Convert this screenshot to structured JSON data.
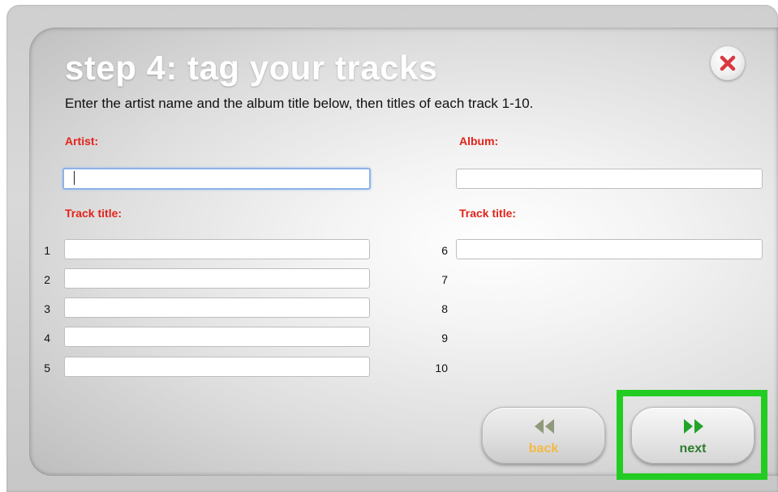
{
  "dialog": {
    "title": "step 4: tag your tracks",
    "instructions": "Enter the artist name and the album title below, then titles of each track 1-10."
  },
  "fields": {
    "artist_label": "Artist:",
    "artist_value": "",
    "album_label": "Album:",
    "album_value": "",
    "track_title_label_left": "Track title:",
    "track_title_label_right": "Track title:"
  },
  "tracks": [
    {
      "number": "1",
      "value": ""
    },
    {
      "number": "2",
      "value": ""
    },
    {
      "number": "3",
      "value": ""
    },
    {
      "number": "4",
      "value": ""
    },
    {
      "number": "5",
      "value": ""
    },
    {
      "number": "6",
      "value": ""
    },
    {
      "number": "7",
      "value": ""
    },
    {
      "number": "8",
      "value": ""
    },
    {
      "number": "9",
      "value": ""
    },
    {
      "number": "10",
      "value": ""
    }
  ],
  "buttons": {
    "back_label": "back",
    "next_label": "next"
  },
  "icons": {
    "close": "close-icon",
    "back": "rewind-icon",
    "next": "fast-forward-icon"
  },
  "colors": {
    "label_red": "#e2231a",
    "close_red": "#d9383f",
    "back_orange": "#f4b844",
    "next_green": "#2e7d2e",
    "highlight_green": "#22cc22"
  }
}
